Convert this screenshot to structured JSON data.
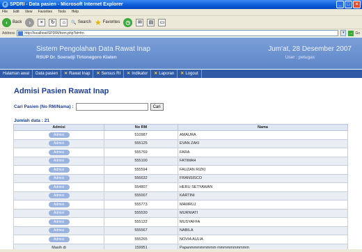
{
  "window": {
    "title": "SPDRI - Data pasien - Microsoft Internet Explorer"
  },
  "menu": [
    "File",
    "Edit",
    "View",
    "Favorites",
    "Tools",
    "Help"
  ],
  "toolbar": {
    "back": "Back",
    "search": "Search",
    "favorites": "Favorites"
  },
  "address": {
    "label": "Address",
    "url": "http://localhost/SPDRI/form.php?id=frn",
    "go": "Go"
  },
  "header": {
    "app_title": "Sistem Pengolahan Data Rawat Inap",
    "hospital": "RSUP Dr. Soeradji Tirtonegoro Klaten",
    "date": "Jum'at, 28 Desember 2007",
    "user": "User : petugas"
  },
  "nav": [
    {
      "label": "Halaman awal",
      "x": false
    },
    {
      "label": "Data pasien",
      "x": false
    },
    {
      "label": "Rawat Inap",
      "x": true
    },
    {
      "label": "Sensus RI",
      "x": true
    },
    {
      "label": "Indikator",
      "x": true
    },
    {
      "label": "Laporan",
      "x": true
    },
    {
      "label": "Logout",
      "x": true
    }
  ],
  "page": {
    "title": "Admisi Pasien Rawat Inap",
    "search_label": "Cari Pasien (No RM/Nama) :",
    "search_value": "",
    "search_button": "Cari",
    "count_label": "Jumlah data : 21"
  },
  "table": {
    "headers": [
      "Admisi",
      "No RM",
      "Nama"
    ],
    "rows": [
      {
        "admisi": "Admisi",
        "no_rm": "510987",
        "nama": "AMAURA"
      },
      {
        "admisi": "Admisi",
        "no_rm": "555125",
        "nama": "EVAN ZAKI"
      },
      {
        "admisi": "Admisi",
        "no_rm": "555769",
        "nama": "FARA"
      },
      {
        "admisi": "Admisi",
        "no_rm": "555100",
        "nama": "FATIMAH"
      },
      {
        "admisi": "Admisi",
        "no_rm": "555594",
        "nama": "FAUZAN RIZKI"
      },
      {
        "admisi": "Admisi",
        "no_rm": "556632",
        "nama": "FRANSISCO"
      },
      {
        "admisi": "Admisi",
        "no_rm": "554807",
        "nama": "HERU SETYAWAN"
      },
      {
        "admisi": "Admisi",
        "no_rm": "555007",
        "nama": "KARTINI"
      },
      {
        "admisi": "Admisi",
        "no_rm": "555773",
        "nama": "MAMRUJ"
      },
      {
        "admisi": "Admisi",
        "no_rm": "555530",
        "nama": "MURNIATI"
      },
      {
        "admisi": "Admisi",
        "no_rm": "555122",
        "nama": "MUSYAFFA"
      },
      {
        "admisi": "Admisi",
        "no_rm": "555567",
        "nama": "NABILA"
      },
      {
        "admisi": "Admisi",
        "no_rm": "555265",
        "nama": "NOVIA AULIA"
      },
      {
        "admisi": "Masih di",
        "no_rm": "159951",
        "nama": "Papanmmmmmmmm mmmmmmmmmm"
      }
    ]
  }
}
